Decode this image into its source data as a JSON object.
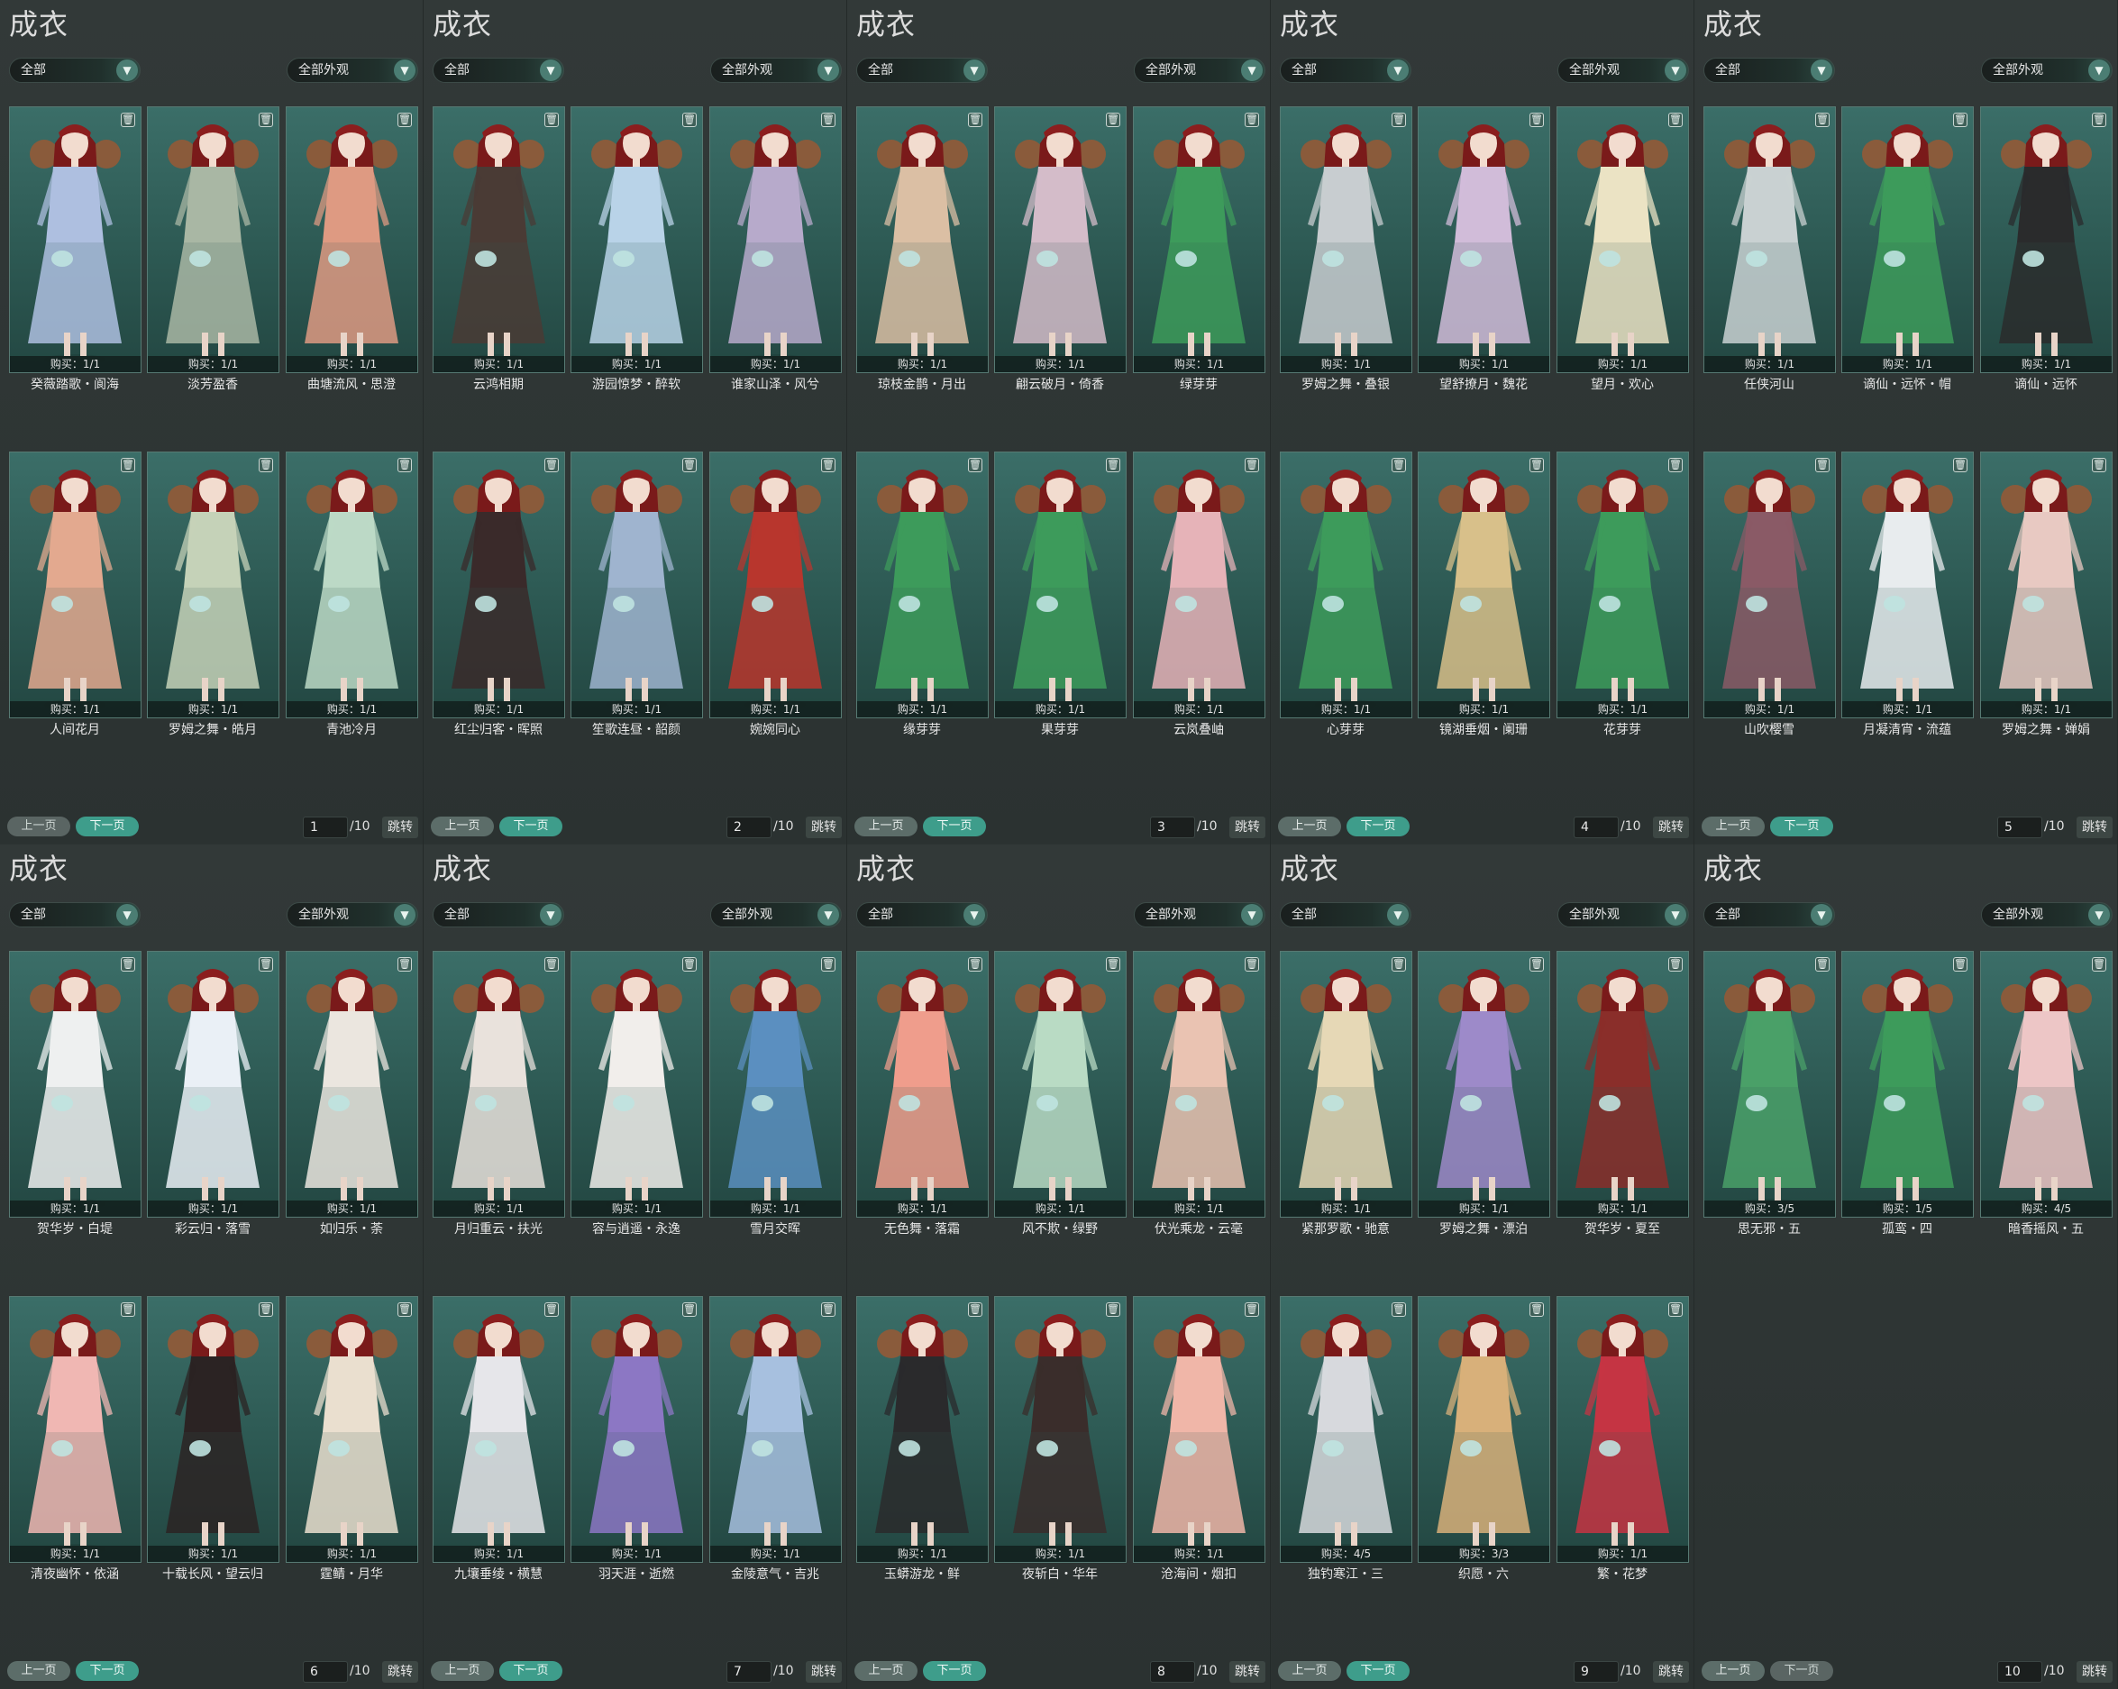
{
  "common": {
    "title": "成衣",
    "filter_category": "全部",
    "filter_appearance": "全部外观",
    "prev_label": "上一页",
    "next_label": "下一页",
    "jump_label": "跳转",
    "page_total": "/10",
    "trash_icon": "trash-icon"
  },
  "panels": [
    {
      "page": "1",
      "items": [
        {
          "name": "癸薇踏歌・阆海",
          "buy": "购买：1/1",
          "color": "#aebfe0"
        },
        {
          "name": "淡芳盈香",
          "buy": "购买：1/1",
          "color": "#a9b7a4"
        },
        {
          "name": "曲塘流风・思澄",
          "buy": "购买：1/1",
          "color": "#de9a82"
        },
        {
          "name": "人间花月",
          "buy": "购买：1/1",
          "color": "#e3a98f"
        },
        {
          "name": "罗姆之舞・皓月",
          "buy": "购买：1/1",
          "color": "#c5d2b8"
        },
        {
          "name": "青池冷月",
          "buy": "购买：1/1",
          "color": "#bcd9c6"
        }
      ]
    },
    {
      "page": "2",
      "items": [
        {
          "name": "云鸿相期",
          "buy": "购买：1/1",
          "color": "#4a3b35"
        },
        {
          "name": "游园惊梦・醉软",
          "buy": "购买：1/1",
          "color": "#b9d3e8"
        },
        {
          "name": "谁家山泽・风兮",
          "buy": "购买：1/1",
          "color": "#b7aacb"
        },
        {
          "name": "红尘归客・晖照",
          "buy": "购买：1/1",
          "color": "#3a2a2a"
        },
        {
          "name": "笙歌连昼・韶颜",
          "buy": "购买：1/1",
          "color": "#9fb4cf"
        },
        {
          "name": "婉婉同心",
          "buy": "购买：1/1",
          "color": "#b8362d"
        }
      ]
    },
    {
      "page": "3",
      "items": [
        {
          "name": "琼枝金鹊・月出",
          "buy": "购买：1/1",
          "color": "#dbbfa4"
        },
        {
          "name": "翩云破月・倚香",
          "buy": "购买：1/1",
          "color": "#d4bcc9"
        },
        {
          "name": "绿芽芽",
          "buy": "购买：1/1",
          "color": "#3d9b5b"
        },
        {
          "name": "缘芽芽",
          "buy": "购买：1/1",
          "color": "#3d9b5b"
        },
        {
          "name": "果芽芽",
          "buy": "购买：1/1",
          "color": "#3d9b5b"
        },
        {
          "name": "云岚叠岫",
          "buy": "购买：1/1",
          "color": "#e6b3b8"
        }
      ]
    },
    {
      "page": "4",
      "items": [
        {
          "name": "罗姆之舞・叠银",
          "buy": "购买：1/1",
          "color": "#c8cdd0"
        },
        {
          "name": "望舒撩月・魏花",
          "buy": "购买：1/1",
          "color": "#d1bcd9"
        },
        {
          "name": "望月・欢心",
          "buy": "购买：1/1",
          "color": "#ebe3c4"
        },
        {
          "name": "心芽芽",
          "buy": "购买：1/1",
          "color": "#3d9b5b"
        },
        {
          "name": "镜湖垂烟・阑珊",
          "buy": "购买：1/1",
          "color": "#d8c08a"
        },
        {
          "name": "花芽芽",
          "buy": "购买：1/1",
          "color": "#3d9b5b"
        }
      ]
    },
    {
      "page": "5",
      "items": [
        {
          "name": "任侠河山",
          "buy": "购买：1/1",
          "color": "#c9d1d2"
        },
        {
          "name": "谪仙・远怀・帽",
          "buy": "购买：1/1",
          "color": "#3d9b5b"
        },
        {
          "name": "谪仙・远怀",
          "buy": "购买：1/1",
          "color": "#2a2b2c"
        },
        {
          "name": "山吹樱雪",
          "buy": "购买：1/1",
          "color": "#8a5a66"
        },
        {
          "name": "月凝清宵・流蕴",
          "buy": "购买：1/1",
          "color": "#e8ecee"
        },
        {
          "name": "罗姆之舞・婵娟",
          "buy": "购买：1/1",
          "color": "#e8c9c2"
        }
      ]
    },
    {
      "page": "6",
      "items": [
        {
          "name": "贺华岁・白堤",
          "buy": "购买：1/1",
          "color": "#eef0f0"
        },
        {
          "name": "彩云归・落雪",
          "buy": "购买：1/1",
          "color": "#eaf0f6"
        },
        {
          "name": "如归乐・荼",
          "buy": "购买：1/1",
          "color": "#ebe6df"
        },
        {
          "name": "清夜幽怀・依涵",
          "buy": "购买：1/1",
          "color": "#f0b7b3"
        },
        {
          "name": "十载长风・望云归",
          "buy": "购买：1/1",
          "color": "#2b2323"
        },
        {
          "name": "霆鲭・月华",
          "buy": "购买：1/1",
          "color": "#eadfcf"
        }
      ]
    },
    {
      "page": "7",
      "items": [
        {
          "name": "月归重云・扶光",
          "buy": "购买：1/1",
          "color": "#e9e2dc"
        },
        {
          "name": "容与逍遥・永逸",
          "buy": "购买：1/1",
          "color": "#f1eeeb"
        },
        {
          "name": "雪月交晖",
          "buy": "购买：1/1",
          "color": "#5b8fc0"
        },
        {
          "name": "九壤垂绫・横慧",
          "buy": "购买：1/1",
          "color": "#e6e6ea"
        },
        {
          "name": "羽天涯・逝燃",
          "buy": "购买：1/1",
          "color": "#8c77c4"
        },
        {
          "name": "金陵意气・吉兆",
          "buy": "购买：1/1",
          "color": "#a7c0df"
        }
      ]
    },
    {
      "page": "8",
      "items": [
        {
          "name": "无色舞・落霜",
          "buy": "购买：1/1",
          "color": "#ef9d8c"
        },
        {
          "name": "风不欺・绿野",
          "buy": "购买：1/1",
          "color": "#b9dbc4"
        },
        {
          "name": "伏光乘龙・云毫",
          "buy": "购买：1/1",
          "color": "#eac3b2"
        },
        {
          "name": "玉蟒游龙・鲜",
          "buy": "购买：1/1",
          "color": "#2a2a2c"
        },
        {
          "name": "夜斩白・华年",
          "buy": "购买：1/1",
          "color": "#3a2d2b"
        },
        {
          "name": "沧海间・烟扣",
          "buy": "购买：1/1",
          "color": "#f0b6a8"
        }
      ]
    },
    {
      "page": "9",
      "items": [
        {
          "name": "紧那罗歌・驰意",
          "buy": "购买：1/1",
          "color": "#e6d8b6"
        },
        {
          "name": "罗姆之舞・漂泊",
          "buy": "购买：1/1",
          "color": "#9d8ac9"
        },
        {
          "name": "贺华岁・夏至",
          "buy": "购买：1/1",
          "color": "#8a2e2a"
        },
        {
          "name": "独钓寒江・三",
          "buy": "购买：4/5",
          "color": "#d7d9dd"
        },
        {
          "name": "织愿・六",
          "buy": "购买：3/3",
          "color": "#d8b07a"
        },
        {
          "name": "繁・花梦",
          "buy": "购买：1/1",
          "color": "#c53443"
        }
      ]
    },
    {
      "page": "10",
      "items": [
        {
          "name": "思无邪・五",
          "buy": "购买：3/5",
          "color": "#4aa068"
        },
        {
          "name": "孤鸾・四",
          "buy": "购买：1/5",
          "color": "#3d9b5b"
        },
        {
          "name": "暗香摇风・五",
          "buy": "购买：4/5",
          "color": "#edc6c6"
        }
      ]
    }
  ]
}
